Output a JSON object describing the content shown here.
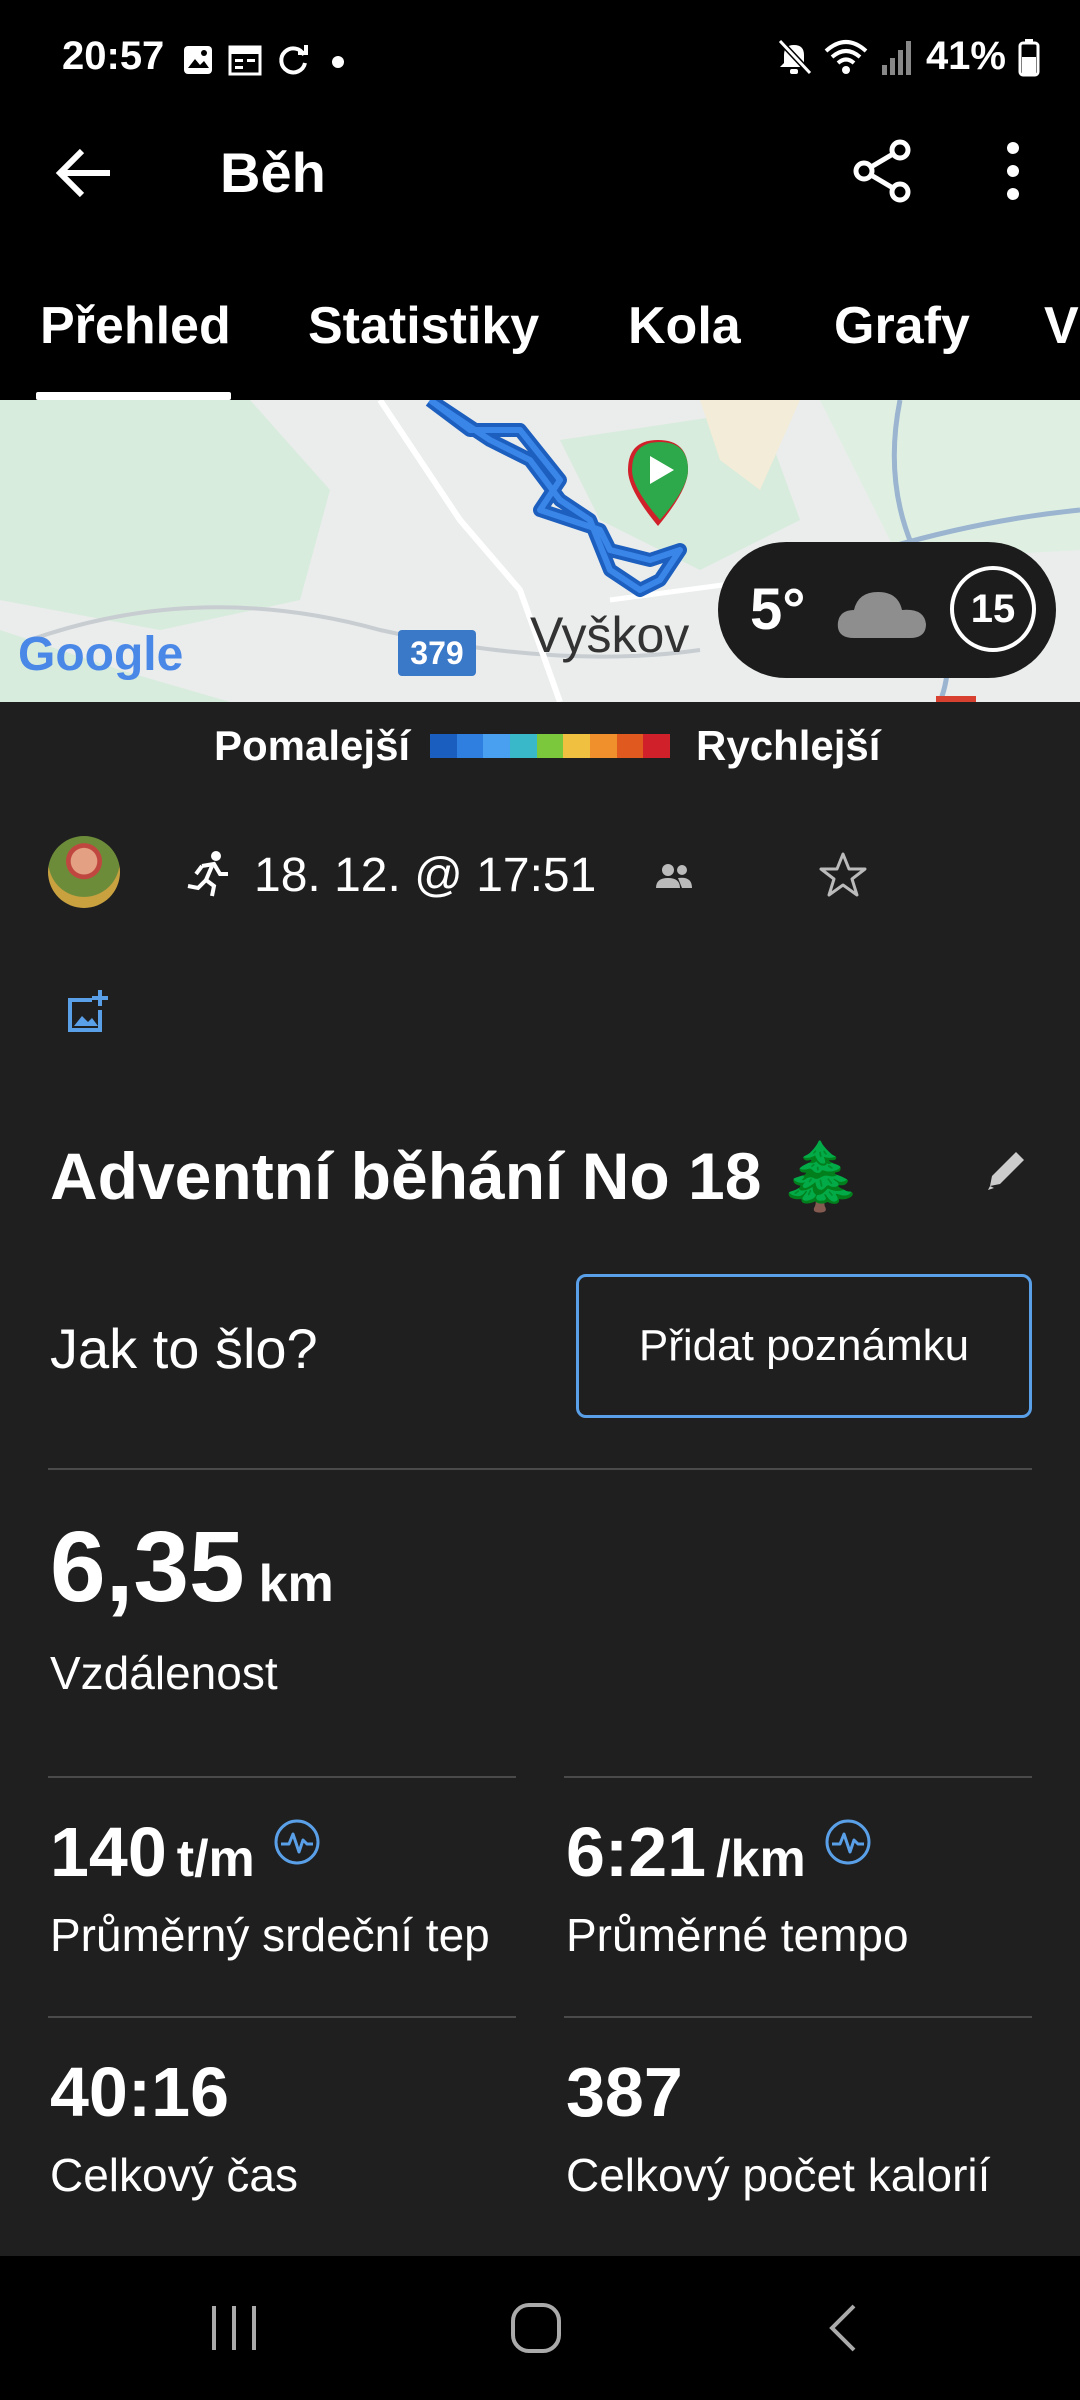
{
  "status_bar": {
    "time": "20:57",
    "battery": "41%"
  },
  "app_bar": {
    "title": "Běh"
  },
  "tabs": [
    {
      "label": "Přehled",
      "active": true
    },
    {
      "label": "Statistiky"
    },
    {
      "label": "Kola"
    },
    {
      "label": "Grafy"
    },
    {
      "label": "V"
    }
  ],
  "map": {
    "town_label": "Vyškov",
    "road_number": "379",
    "google_logo": "Google",
    "weather": {
      "temperature": "5°",
      "wind": "15"
    }
  },
  "pace_legend": {
    "slower": "Pomalejší",
    "faster": "Rychlejší",
    "colors": [
      "#1a5fbf",
      "#2e7fe0",
      "#4aa0f0",
      "#38b8c8",
      "#7cc83c",
      "#f0c040",
      "#f0902c",
      "#e05a20",
      "#d0202a"
    ]
  },
  "activity": {
    "date": "18. 12. @ 17:51",
    "title": "Adventní běhání No 18 🌲",
    "how_label": "Jak to šlo?",
    "add_note_button": "Přidat poznámku"
  },
  "stats": {
    "distance": {
      "value": "6,35",
      "unit": "km",
      "label": "Vzdálenost"
    },
    "heart_rate": {
      "value": "140",
      "unit": "t/m",
      "label": "Průměrný srdeční tep"
    },
    "pace": {
      "value": "6:21",
      "unit": "/km",
      "label": "Průměrné tempo"
    },
    "total_time": {
      "value": "40:16",
      "label": "Celkový čas"
    },
    "calories": {
      "value": "387",
      "label": "Celkový počet kalorií"
    }
  },
  "colors": {
    "accent": "#5aa0e8",
    "background": "#1f1f1f",
    "bars": "#000000"
  }
}
